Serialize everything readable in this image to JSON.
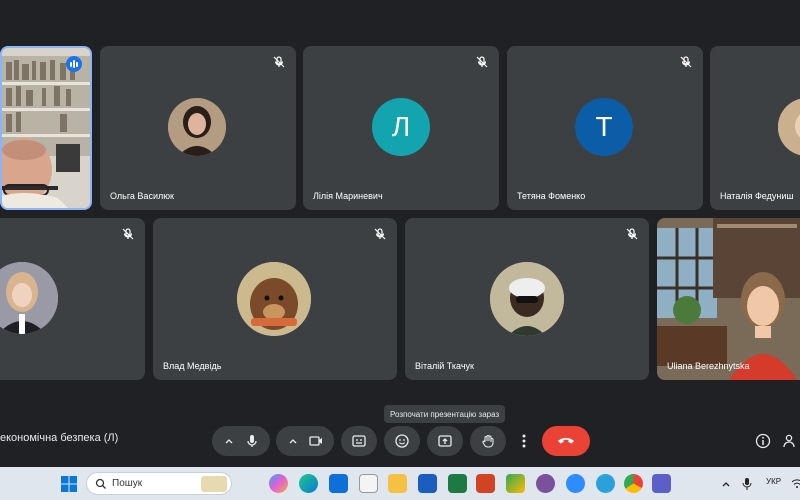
{
  "participants": [
    {
      "name": "Ольга Василюк"
    },
    {
      "name": "Лілія Мариневич",
      "initial": "Л",
      "color": "#12a4af"
    },
    {
      "name": "Тетяна Фоменко",
      "initial": "Т",
      "color": "#0b5da8"
    },
    {
      "name": "Наталія Федуниш"
    },
    {
      "name": "Влад Медвідь"
    },
    {
      "name": "Віталій Ткачук"
    },
    {
      "name": "Uliana Berezhnytska"
    }
  ],
  "meeting": {
    "title": "економічна безпека (Л)"
  },
  "tooltip": "Розпочати презентацію зараз",
  "controls": {
    "mic": "mic-icon",
    "camera": "camera-icon",
    "captions": "captions-icon",
    "emoji": "emoji-icon",
    "present": "present-icon",
    "hand": "raise-hand-icon",
    "more": "more-icon",
    "leave": "leave-call-icon",
    "leave_color": "#ea4335",
    "info": "info-icon",
    "people": "people-icon"
  },
  "taskbar": {
    "search_placeholder": "Пошук",
    "language": "УКР"
  }
}
